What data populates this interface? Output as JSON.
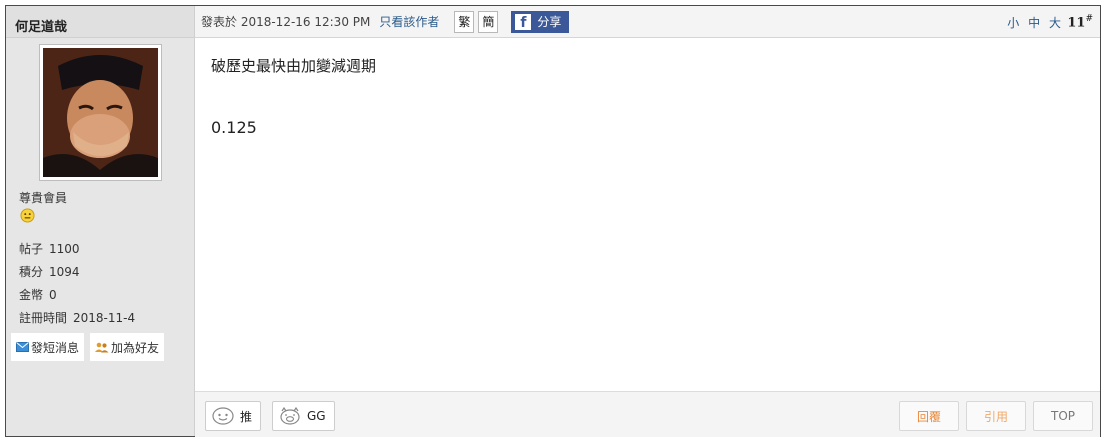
{
  "author": {
    "name": "何足道哉",
    "rank": "尊貴會員",
    "stats": [
      {
        "label": "帖子",
        "value": "1100"
      },
      {
        "label": "積分",
        "value": "1094"
      },
      {
        "label": "金幣",
        "value": "0"
      },
      {
        "label": "註冊時間",
        "value": "2018-11-4"
      }
    ],
    "send_message": "發短消息",
    "add_friend": "加為好友"
  },
  "post": {
    "posted_at": "發表於 2018-12-16 12:30 PM",
    "author_only": "只看該作者",
    "traditional": "繁",
    "simplified": "簡",
    "share": "分享",
    "font_sizes": [
      "小",
      "中",
      "大"
    ],
    "floor": "11",
    "floor_suffix": "#",
    "lines": [
      "破歷史最快由加變減週期",
      "0.125"
    ]
  },
  "footer": {
    "push": "推",
    "gg": "GG",
    "reply": "回覆",
    "quote": "引用",
    "top": "TOP"
  },
  "colors": {
    "link": "#2a5a8a",
    "facebook": "#3b5998",
    "reply_text": "#e8883a",
    "quote_text": "#f0a868",
    "top_text": "#777777"
  }
}
